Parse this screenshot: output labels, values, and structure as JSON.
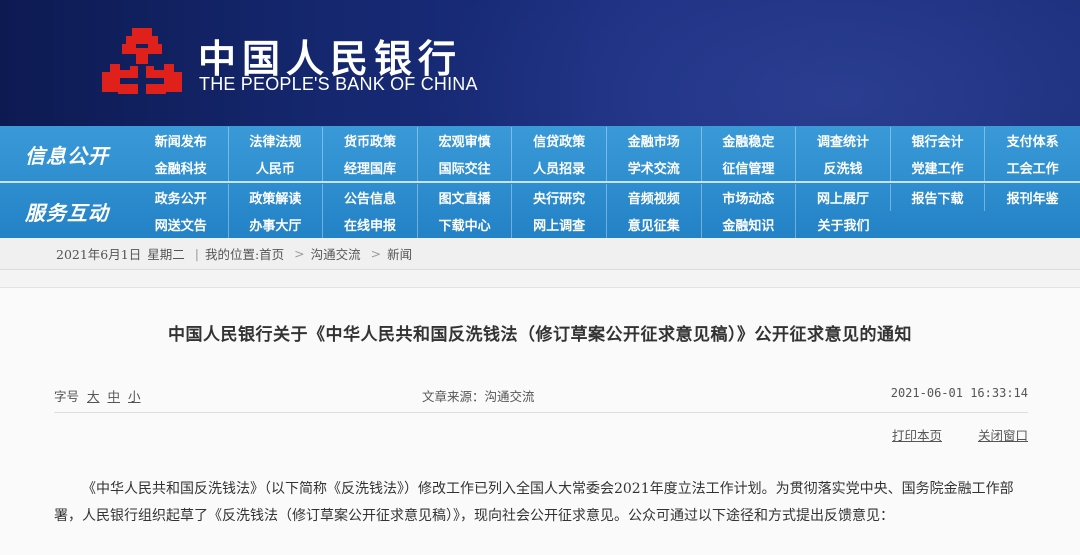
{
  "brand": {
    "name_cn": "中国人民银行",
    "name_en": "THE PEOPLE'S BANK OF CHINA",
    "logo_icon": "pboc-logo-icon",
    "logo_color": "#e0201b"
  },
  "nav": {
    "groups": [
      {
        "label": "信息公开",
        "rows": [
          [
            "新闻发布",
            "法律法规",
            "货币政策",
            "宏观审慎",
            "信贷政策",
            "金融市场",
            "金融稳定",
            "调查统计",
            "银行会计",
            "支付体系"
          ],
          [
            "金融科技",
            "人民币",
            "经理国库",
            "国际交往",
            "人员招录",
            "学术交流",
            "征信管理",
            "反洗钱",
            "党建工作",
            "工会工作"
          ]
        ]
      },
      {
        "label": "服务互动",
        "rows": [
          [
            "政务公开",
            "政策解读",
            "公告信息",
            "图文直播",
            "央行研究",
            "音频视频",
            "市场动态",
            "网上展厅",
            "报告下载",
            "报刊年鉴"
          ],
          [
            "网送文告",
            "办事大厅",
            "在线申报",
            "下载中心",
            "网上调查",
            "意见征集",
            "金融知识",
            "关于我们"
          ]
        ]
      }
    ]
  },
  "breadcrumb": {
    "date": "2021年6月1日",
    "weekday": "星期二",
    "location_label": "我的位置:首页",
    "level1": "沟通交流",
    "level2": "新闻"
  },
  "article": {
    "title": "中国人民银行关于《中华人民共和国反洗钱法（修订草案公开征求意见稿）》公开征求意见的通知",
    "font_size_label": "字号",
    "font_sizes": [
      "大",
      "中",
      "小"
    ],
    "source": "文章来源：沟通交流",
    "published": "2021-06-01 16:33:14",
    "print_label": "打印本页",
    "close_label": "关闭窗口",
    "body": "《中华人民共和国反洗钱法》（以下简称《反洗钱法》）修改工作已列入全国人大常委会2021年度立法工作计划。为贯彻落实党中央、国务院金融工作部署，人民银行组织起草了《反洗钱法（修订草案公开征求意见稿）》，现向社会公开征求意见。公众可通过以下途径和方式提出反馈意见："
  }
}
